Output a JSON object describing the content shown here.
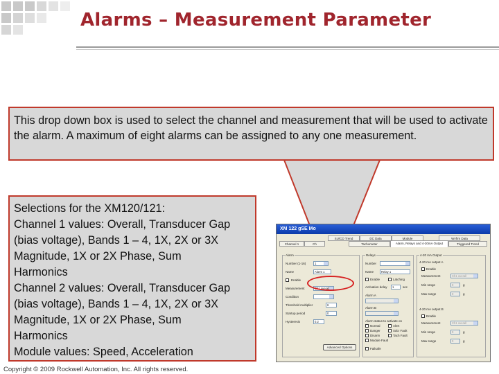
{
  "title": "Alarms – Measurement Parameter",
  "callout_top": "This drop down box is used to select the channel and measurement that will be used to activate the alarm. A maximum of eight alarms can be assigned to any one measurement.",
  "callout_left": {
    "lines": [
      "Selections for the XM120/121:",
      "Channel 1 values: Overall, Transducer Gap",
      "(bias voltage), Bands 1 – 4, 1X,  2X or  3X",
      "Magnitude, 1X or 2X Phase, Sum",
      "Harmonics",
      "Channel 2 values: Overall, Transducer Gap",
      "(bias voltage), Bands 1 – 4, 1X,  2X or  3X",
      "Magnitude, 1X or 2X Phase, Sum",
      "Harmonics",
      "Module values: Speed, Acceleration"
    ]
  },
  "copyright": "Copyright © 2009 Rockwell Automation, Inc. All rights reserved.",
  "window": {
    "title": "XM 122 gSE Mo",
    "tabs_row1": [
      "SU/CD Trend",
      "DC Data",
      "Module",
      "Wvfrm Data"
    ],
    "tabs_row2": [
      "Channel 1",
      "Ch",
      "Tachometer",
      "Alarm, Relays and 4-20mA Output",
      "Triggered Trend"
    ],
    "alarm": {
      "group": "Alarm",
      "number_label": "Number (1-16)",
      "number_value": "1",
      "name_label": "Name",
      "name_value": "Alarm 1",
      "enable_label": "Enable",
      "measurement_label": "Measurement",
      "measurement_value": "Ch1 overall",
      "condition_label": "Condition",
      "hysteresis_label": "Hysteresis",
      "hysteresis_value": "0.2",
      "startup_label": "Startup period",
      "startup_value": "0",
      "threshold_label": "Threshold multiplier",
      "threshold_value": "6",
      "button_label": "Advanced Options"
    },
    "relays": {
      "group": "Relays",
      "number_label": "Number",
      "name_label": "Name",
      "name_value": "Relay 1",
      "enable_label": "Enable",
      "latching_label": "Latching",
      "activation_delay_label": "Activation delay",
      "activation_delay_value": "1",
      "unit": "sec",
      "alarm_a_label": "Alarm A",
      "alarm_b_label": "Alarm B",
      "status_group": "Alarm status to activate on",
      "status": [
        "Normal",
        "Alert",
        "Danger",
        "Xdcr Fault",
        "Disarm",
        "Tach Fault",
        "Module Fault"
      ],
      "failsafe_label": "Failsafe"
    },
    "output": {
      "group": "4-20 mA Output",
      "output_a": "4-20 mA output A",
      "output_b": "4-20 mA output B",
      "enable_label": "Enable",
      "measurement_label": "Measurement",
      "measurement_value": "Ch1 overall",
      "min_range_label": "Min range",
      "max_range_label": "Max range",
      "range_value": "0",
      "range_unit": "g"
    }
  }
}
